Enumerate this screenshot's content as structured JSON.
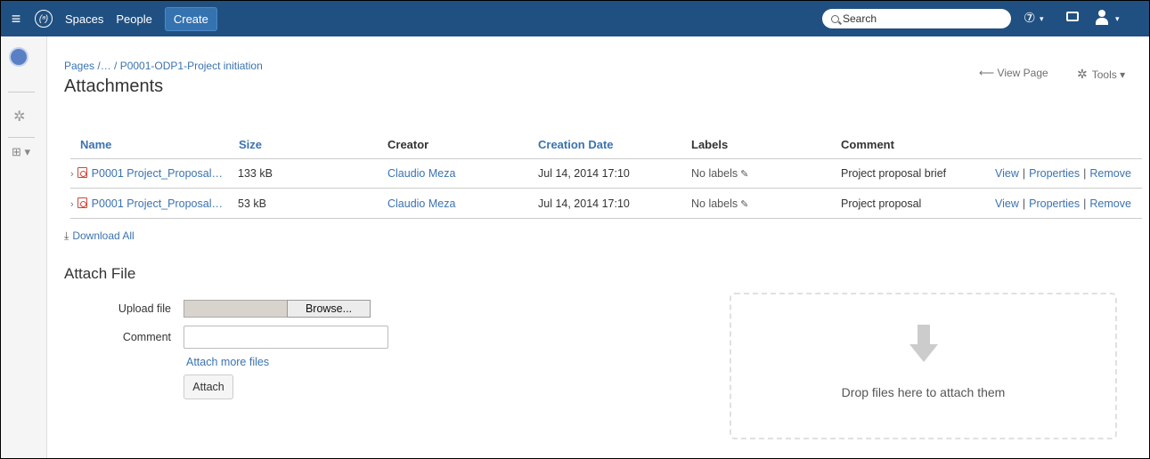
{
  "topnav": {
    "menu_icon": "hamburger-icon",
    "logo_icon": "un-logo-icon",
    "logo_glyph": "(ᵃ)",
    "spaces": "Spaces",
    "people": "People",
    "create": "Create",
    "search_placeholder": "Search",
    "help_glyph": "⑦",
    "colors": {
      "bar": "#205081",
      "create": "#3572b0"
    }
  },
  "sidebar": {
    "items": [
      "un-logo-icon",
      "gear-icon",
      "page-tree-icon"
    ]
  },
  "page": {
    "breadcrumb": "Pages /… / P0001-ODP1-Project initiation",
    "title": "Attachments",
    "view_page": "View Page",
    "tools": "Tools"
  },
  "table": {
    "headers": [
      "Name",
      "Size",
      "Creator",
      "Creation Date",
      "Labels",
      "Comment"
    ],
    "rows": [
      {
        "name": "P0001 Project_Proposal…",
        "size": "133 kB",
        "creator": "Claudio Meza",
        "date": "Jul 14, 2014 17:10",
        "labels": "No labels",
        "comment": "Project proposal brief",
        "view": "View",
        "properties": "Properties",
        "remove": "Remove"
      },
      {
        "name": "P0001 Project_Proposal…",
        "size": "53 kB",
        "creator": "Claudio Meza",
        "date": "Jul 14, 2014 17:10",
        "labels": "No labels",
        "comment": "Project proposal",
        "view": "View",
        "properties": "Properties",
        "remove": "Remove"
      }
    ],
    "separator": "|"
  },
  "download_all": "Download All",
  "attach": {
    "title": "Attach File",
    "upload_label": "Upload file",
    "browse": "Browse...",
    "comment_label": "Comment",
    "comment_value": "",
    "attach_more": "Attach more files",
    "attach_button": "Attach",
    "drop_text": "Drop files here to attach them"
  }
}
